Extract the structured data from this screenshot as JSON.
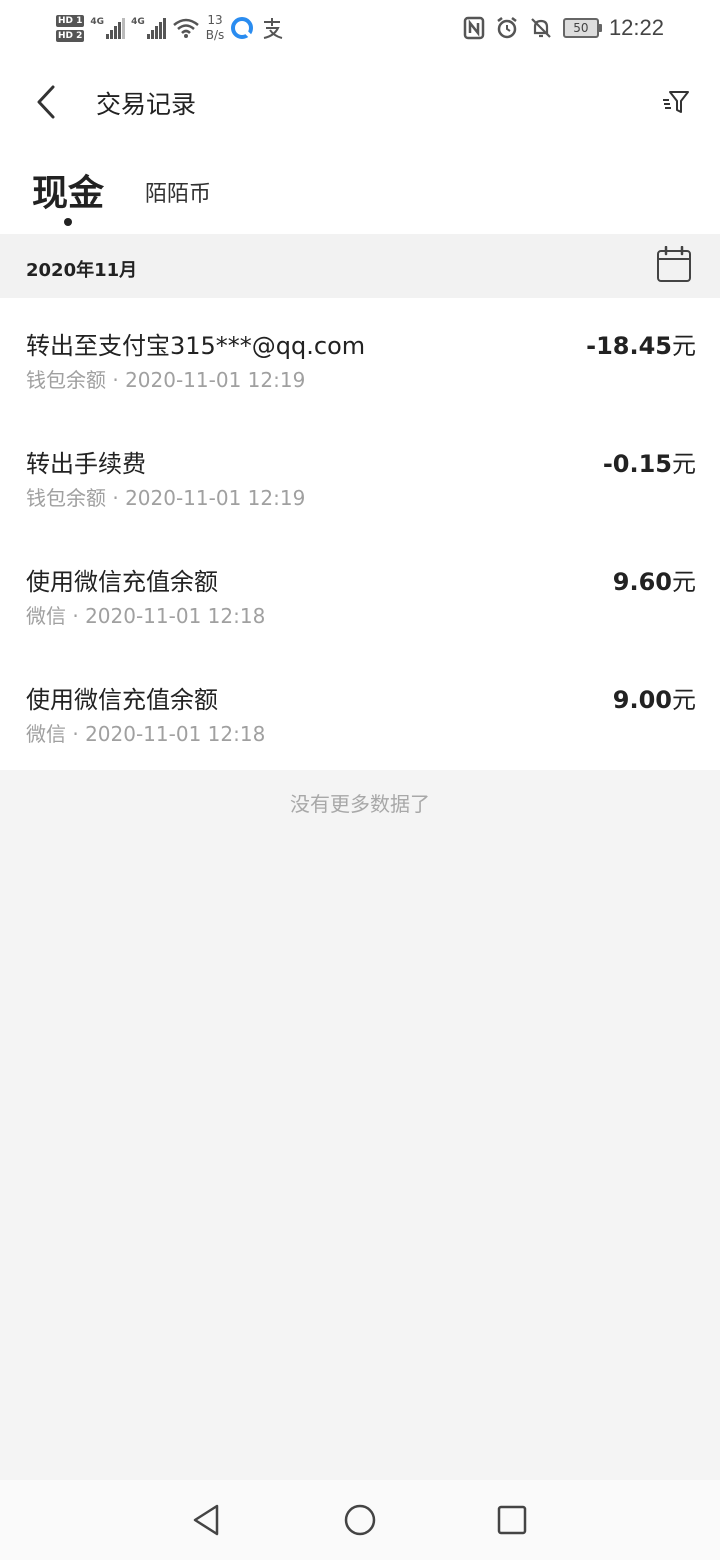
{
  "status_bar": {
    "hd1": "HD 1",
    "hd2": "HD 2",
    "net1": "4G",
    "net2": "4G",
    "speed_value": "13",
    "speed_unit": "B/s",
    "battery": "50",
    "time": "12:22",
    "icons": [
      "nfc-icon",
      "alarm-icon",
      "bell-off-icon"
    ]
  },
  "header": {
    "title": "交易记录"
  },
  "tabs": [
    {
      "label": "现金",
      "active": true
    },
    {
      "label": "陌陌币",
      "active": false
    }
  ],
  "month": {
    "label": "2020年11月"
  },
  "transactions": [
    {
      "title": "转出至支付宝315***@qq.com",
      "subtitle": "钱包余额 · 2020-11-01 12:19",
      "amount": "-18.45",
      "unit": "元"
    },
    {
      "title": "转出手续费",
      "subtitle": "钱包余额 · 2020-11-01 12:19",
      "amount": "-0.15",
      "unit": "元"
    },
    {
      "title": "使用微信充值余额",
      "subtitle": "微信 · 2020-11-01 12:18",
      "amount": "9.60",
      "unit": "元"
    },
    {
      "title": "使用微信充值余额",
      "subtitle": "微信 · 2020-11-01 12:18",
      "amount": "9.00",
      "unit": "元"
    }
  ],
  "footer_note": "没有更多数据了",
  "colors": {
    "background": "#f4f4f4",
    "surface": "#ffffff",
    "text_primary": "#222222",
    "text_secondary": "#a0a0a0"
  }
}
